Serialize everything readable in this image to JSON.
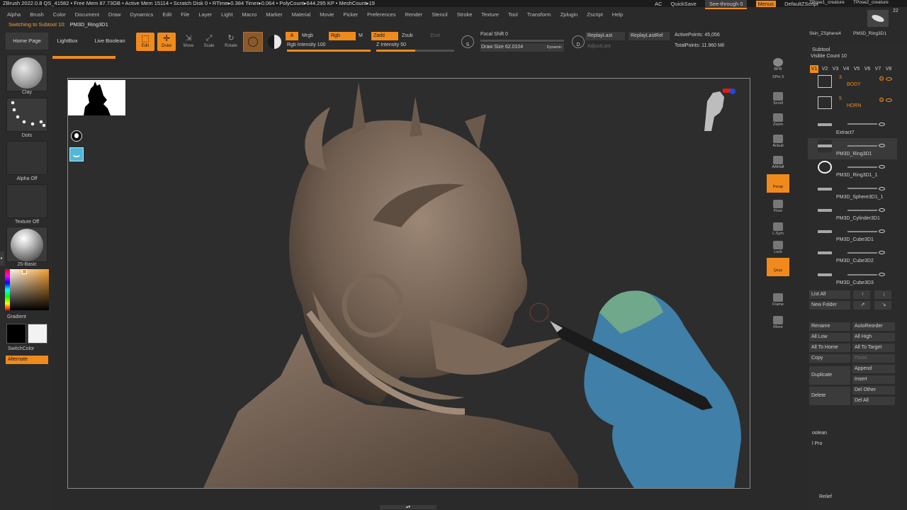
{
  "titlebar": {
    "text": "ZBrush 2022.0.8   QS_41582   • Free Mem 87.73GB • Active Mem 15114 • Scratch Disk 0 • RTime▸0.384 Timer▸0.064 • PolyCount▸644.295 KP • MeshCount▸19",
    "right": {
      "ac": "AC",
      "quicksave": "QuickSave",
      "seethrough": "See-through  0",
      "menus": "Menus",
      "script": "DefaultZScript"
    }
  },
  "menu": [
    "Alpha",
    "Brush",
    "Color",
    "Document",
    "Draw",
    "Dynamics",
    "Edit",
    "File",
    "Layer",
    "Light",
    "Macro",
    "Marker",
    "Material",
    "Movie",
    "Picker",
    "Preferences",
    "Render",
    "Stencil",
    "Stroke",
    "Texture",
    "Tool",
    "Transform",
    "Zplugin",
    "Zscript",
    "Help"
  ],
  "status": {
    "prefix": "Switching to Subtool 10:",
    "name": "PM3D_Ring3D1"
  },
  "toolbar": {
    "home": "Home Page",
    "lightbox": "LightBox",
    "liveboolean": "Live Boolean",
    "edit": "Edit",
    "draw": "Draw",
    "move": "Move",
    "scale": "Scale",
    "rotate": "Rotate",
    "a": "A",
    "mrgb": "Mrgb",
    "rgb": "Rgb",
    "m": "M",
    "zadd": "Zadd",
    "zsub": "Zsub",
    "zcut": "Zcut",
    "rgb_intensity": "Rgb Intensity 100",
    "z_intensity": "Z Intensity 50",
    "focal_shift": "Focal Shift 0",
    "draw_size": "Draw Size 62.0104",
    "dynamic": "Dynamic",
    "replay_last": "ReplayLast",
    "replay_last_rel": "ReplayLastRel",
    "adjust_last": "AdjustLast",
    "active_points": "ActivePoints: 45,056",
    "total_points": "TotalPoints: 11.960 Mil",
    "s_label": "S",
    "d_label": "D",
    "rgb_intensity_value": 1.0,
    "z_intensity_value": 0.5
  },
  "left": {
    "clay": "Clay",
    "dots": "Dots",
    "alpha_off": "Alpha Off",
    "texture_off": "Texture Off",
    "material": "JS-Basic",
    "gradient": "Gradient",
    "switchcolor": "SwitchColor",
    "alternate": "Alternate"
  },
  "right_shelf": [
    "BPR",
    "SPix 3",
    "Scroll",
    "Zoom",
    "Actual",
    "AAHalf",
    "Persp",
    "Floor",
    "L.Sym",
    "Lock",
    "Qxyz",
    "Frame",
    "Move"
  ],
  "tool": {
    "top_thumbs": {
      "left": "TPose1_creature",
      "right": "TPose2_creature",
      "count": "22",
      "sub_left": "Skin_ZSphere4",
      "sub_right": "PM3D_Ring3D1"
    },
    "subtool_title": "Subtool",
    "visible_count": "Visible Count 10",
    "vtabs": [
      "V1",
      "V2",
      "V3",
      "V4",
      "V5",
      "V6",
      "V7",
      "V8"
    ],
    "items": [
      {
        "name": "BODY",
        "num": "3",
        "folder": true
      },
      {
        "name": "HORN",
        "num": "5",
        "folder": true
      },
      {
        "name": "Extract7",
        "folder": false
      },
      {
        "name": "PM3D_Ring3D1",
        "folder": false
      },
      {
        "name": "PM3D_Ring3D1_1",
        "folder": false
      },
      {
        "name": "PM3D_Sphere3D1_1",
        "folder": false
      },
      {
        "name": "PM3D_Cylinder3D1",
        "folder": false
      },
      {
        "name": "PM3D_Cube3D1",
        "folder": false
      },
      {
        "name": "PM3D_Cube3D2",
        "folder": false
      },
      {
        "name": "PM3D_Cube3D3",
        "folder": false
      }
    ],
    "list_all": "List All",
    "new_folder": "New Folder",
    "buttons": {
      "rename": "Rename",
      "autoreorder": "AutoReorder",
      "all_low": "All Low",
      "all_high": "All High",
      "all_to_home": "All To Home",
      "all_to_target": "All To Target",
      "copy": "Copy",
      "paste": "Paste",
      "duplicate": "Duplicate",
      "append": "Append",
      "insert": "Insert",
      "delete": "Delete",
      "del_other": "Del Other",
      "del_all": "Del All",
      "boolean": "oolean",
      "pro": "l Pro",
      "relief": "Relief"
    }
  }
}
